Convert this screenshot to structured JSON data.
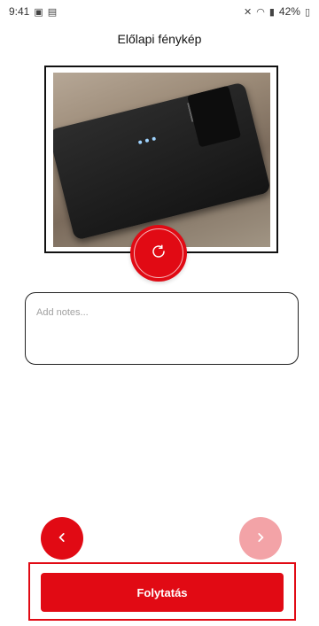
{
  "status_bar": {
    "time": "9:41",
    "battery": "42%",
    "icons_left": [
      "gallery-icon",
      "notification-icon"
    ],
    "icons_right": [
      "mute-icon",
      "wifi-icon",
      "lte-icon",
      "signal-icon",
      "battery-icon"
    ]
  },
  "header": {
    "title": "Előlapi fénykép"
  },
  "photo": {
    "retake_icon": "refresh-icon"
  },
  "notes": {
    "placeholder": "Add notes..."
  },
  "navigation": {
    "prev_icon": "chevron-left-icon",
    "next_icon": "chevron-right-icon",
    "next_enabled": false
  },
  "footer": {
    "continue_label": "Folytatás"
  },
  "colors": {
    "accent": "#e10a14",
    "accent_disabled": "#f3a3a7"
  }
}
